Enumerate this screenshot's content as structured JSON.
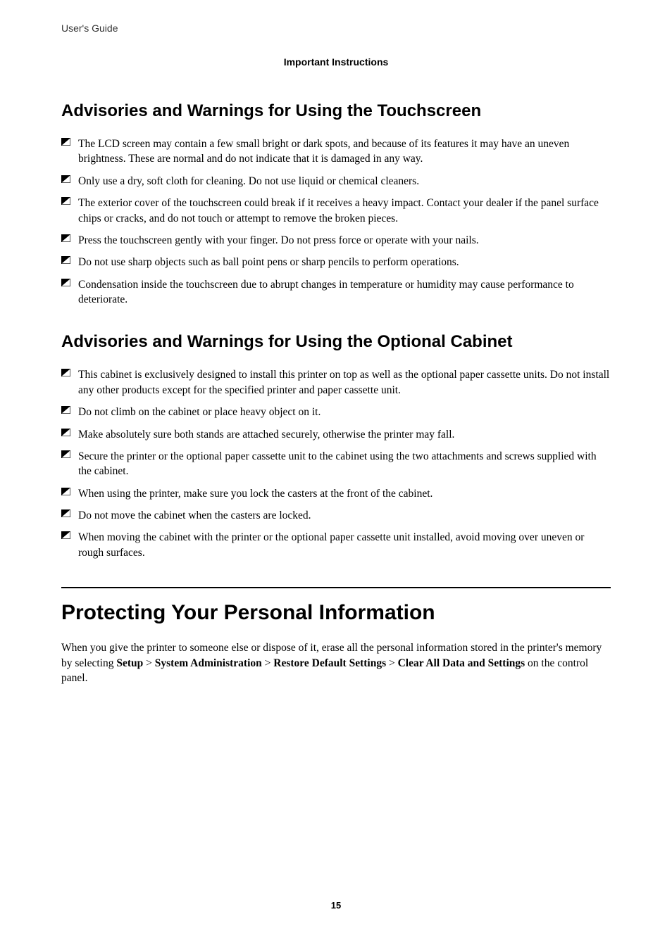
{
  "header": {
    "doc_title": "User's Guide",
    "section_title": "Important Instructions"
  },
  "section1": {
    "heading": "Advisories and Warnings for Using the Touchscreen",
    "items": [
      "The LCD screen may contain a few small bright or dark spots, and because of its features it may have an uneven brightness. These are normal and do not indicate that it is damaged in any way.",
      "Only use a dry, soft cloth for cleaning. Do not use liquid or chemical cleaners.",
      "The exterior cover of the touchscreen could break if it receives a heavy impact. Contact your dealer if the panel surface chips or cracks, and do not touch or attempt to remove the broken pieces.",
      "Press the touchscreen gently with your finger. Do not press force or operate with your nails.",
      "Do not use sharp objects such as ball point pens or sharp pencils to perform operations.",
      "Condensation inside the touchscreen due to abrupt changes in temperature or humidity may cause performance to deteriorate."
    ]
  },
  "section2": {
    "heading": "Advisories and Warnings for Using the Optional Cabinet",
    "items": [
      "This cabinet is exclusively designed to install this printer on top as well as the optional paper cassette units. Do not install any other products except for the specified printer and paper cassette unit.",
      "Do not climb on the cabinet or place heavy object on it.",
      "Make absolutely sure both stands are attached securely, otherwise the printer may fall.",
      "Secure the printer or the optional paper cassette unit to the cabinet using the two attachments and screws supplied with the cabinet.",
      "When using the printer, make sure you lock the casters at the front of the cabinet.",
      "Do not move the cabinet when the casters are locked.",
      "When moving the cabinet with the printer or the optional paper cassette unit installed, avoid moving over uneven or rough surfaces."
    ]
  },
  "section3": {
    "heading": "Protecting Your Personal Information",
    "para_prefix": "When you give the printer to someone else or dispose of it, erase all the personal information stored in the printer's memory by selecting ",
    "bold1": "Setup",
    "sep": " > ",
    "bold2": "System Administration",
    "bold3": "Restore Default Settings",
    "bold4": "Clear All Data and Settings",
    "para_suffix": " on the control panel."
  },
  "page_number": "15"
}
